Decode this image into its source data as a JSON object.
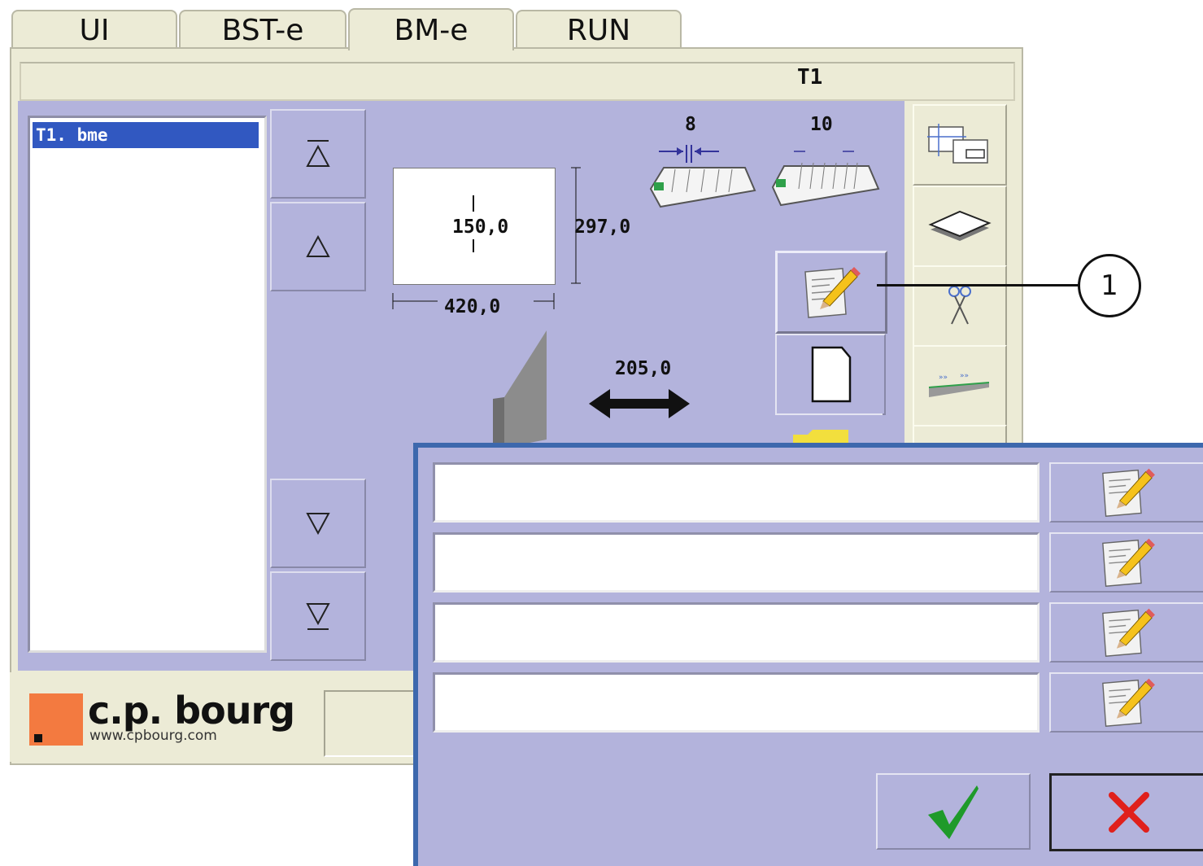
{
  "tabs": [
    {
      "label": "UI"
    },
    {
      "label": "BST-e"
    },
    {
      "label": "BM-e"
    },
    {
      "label": "RUN"
    }
  ],
  "active_tab": "BM-e",
  "window": {
    "title": "T1"
  },
  "file_list": {
    "items": [
      {
        "label": "T1. bme",
        "selected": true
      }
    ]
  },
  "layout_preview": {
    "width": "420,0",
    "height": "297,0",
    "fold_position": "150,0",
    "spacing": "205,0"
  },
  "feeders": [
    {
      "label": "8"
    },
    {
      "label": "10"
    }
  ],
  "callout": {
    "number": "1"
  },
  "brand": {
    "name": "c.p. bourg",
    "url": "www.cpbourg.com"
  },
  "dialog": {
    "fields": [
      {
        "value": ""
      },
      {
        "value": ""
      },
      {
        "value": ""
      },
      {
        "value": ""
      }
    ]
  },
  "colors": {
    "workspace": "#b3b3dc",
    "panel": "#ecebd6",
    "selection": "#3158c1",
    "dialog_border": "#3d68ad",
    "ok_green": "#1f9a2a",
    "cancel_red": "#e0201b",
    "logo_orange": "#f37a40"
  }
}
